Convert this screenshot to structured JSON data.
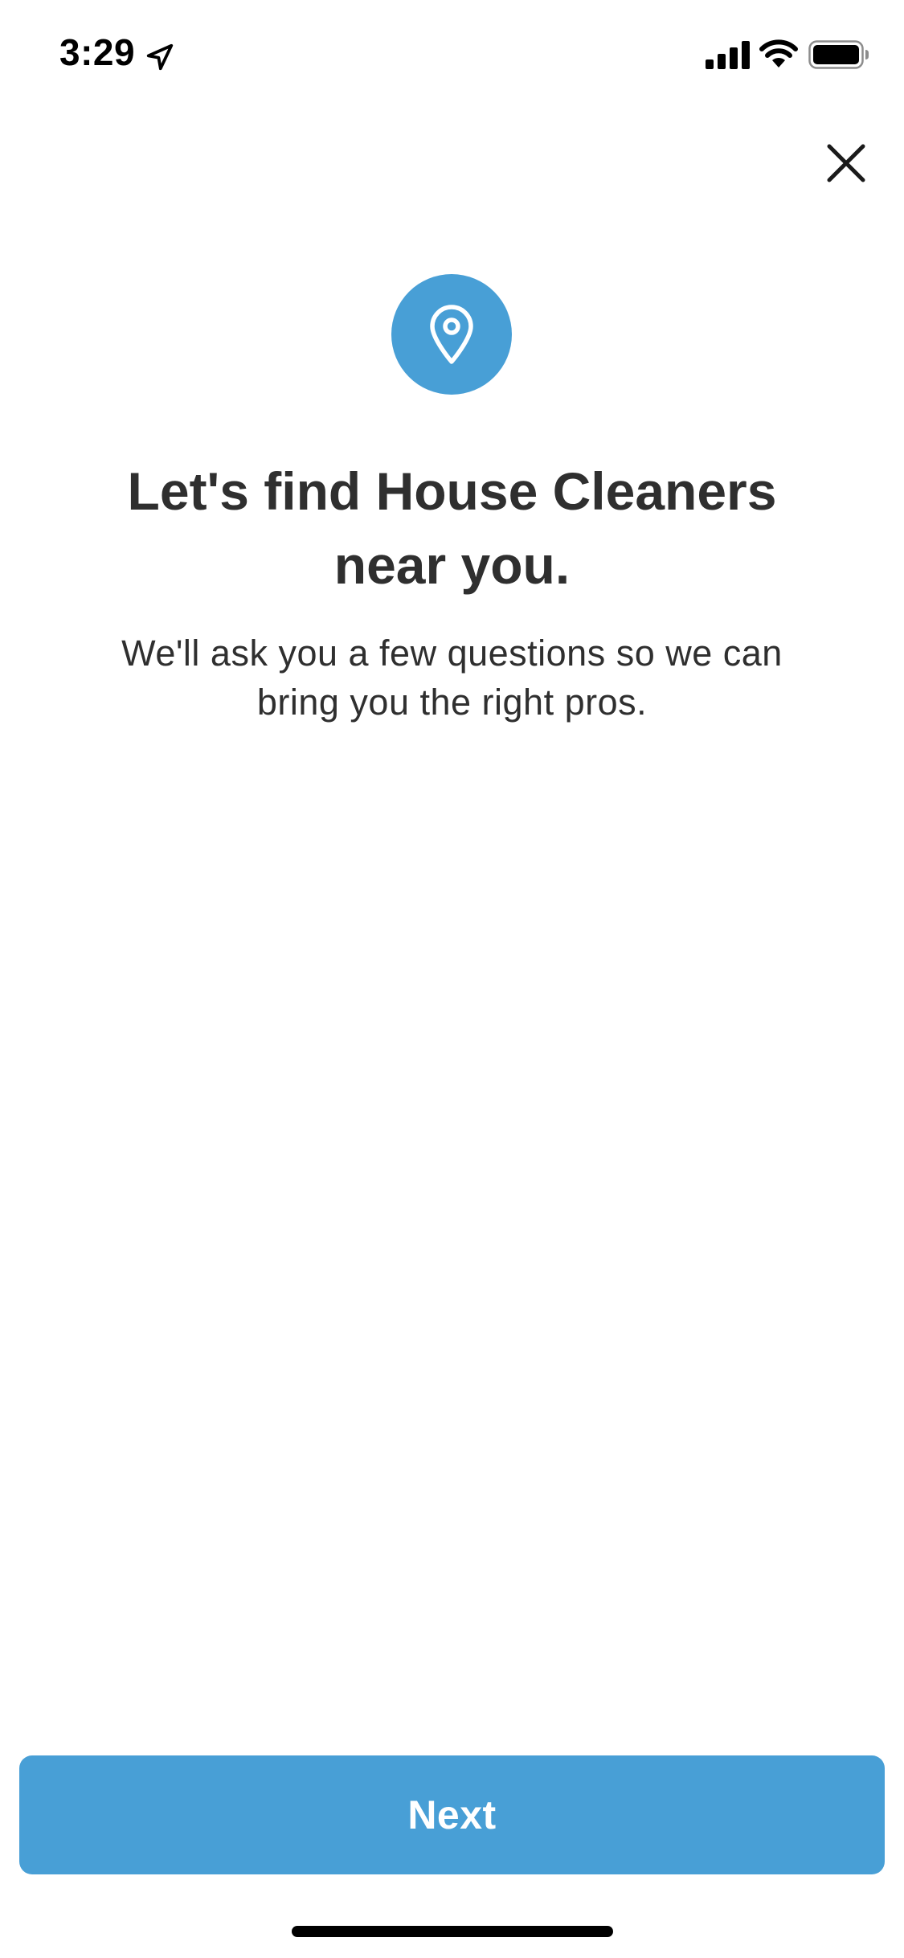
{
  "status_bar": {
    "time": "3:29"
  },
  "header": {
    "close_icon": "close-icon"
  },
  "hero": {
    "icon": "location-pin-icon",
    "icon_bg_color": "#489fd6",
    "headline": "Let's find House Cleaners near you.",
    "subtext": "We'll ask you a few questions so we can bring you the right pros."
  },
  "footer": {
    "next_label": "Next",
    "button_color": "#489fd6"
  }
}
